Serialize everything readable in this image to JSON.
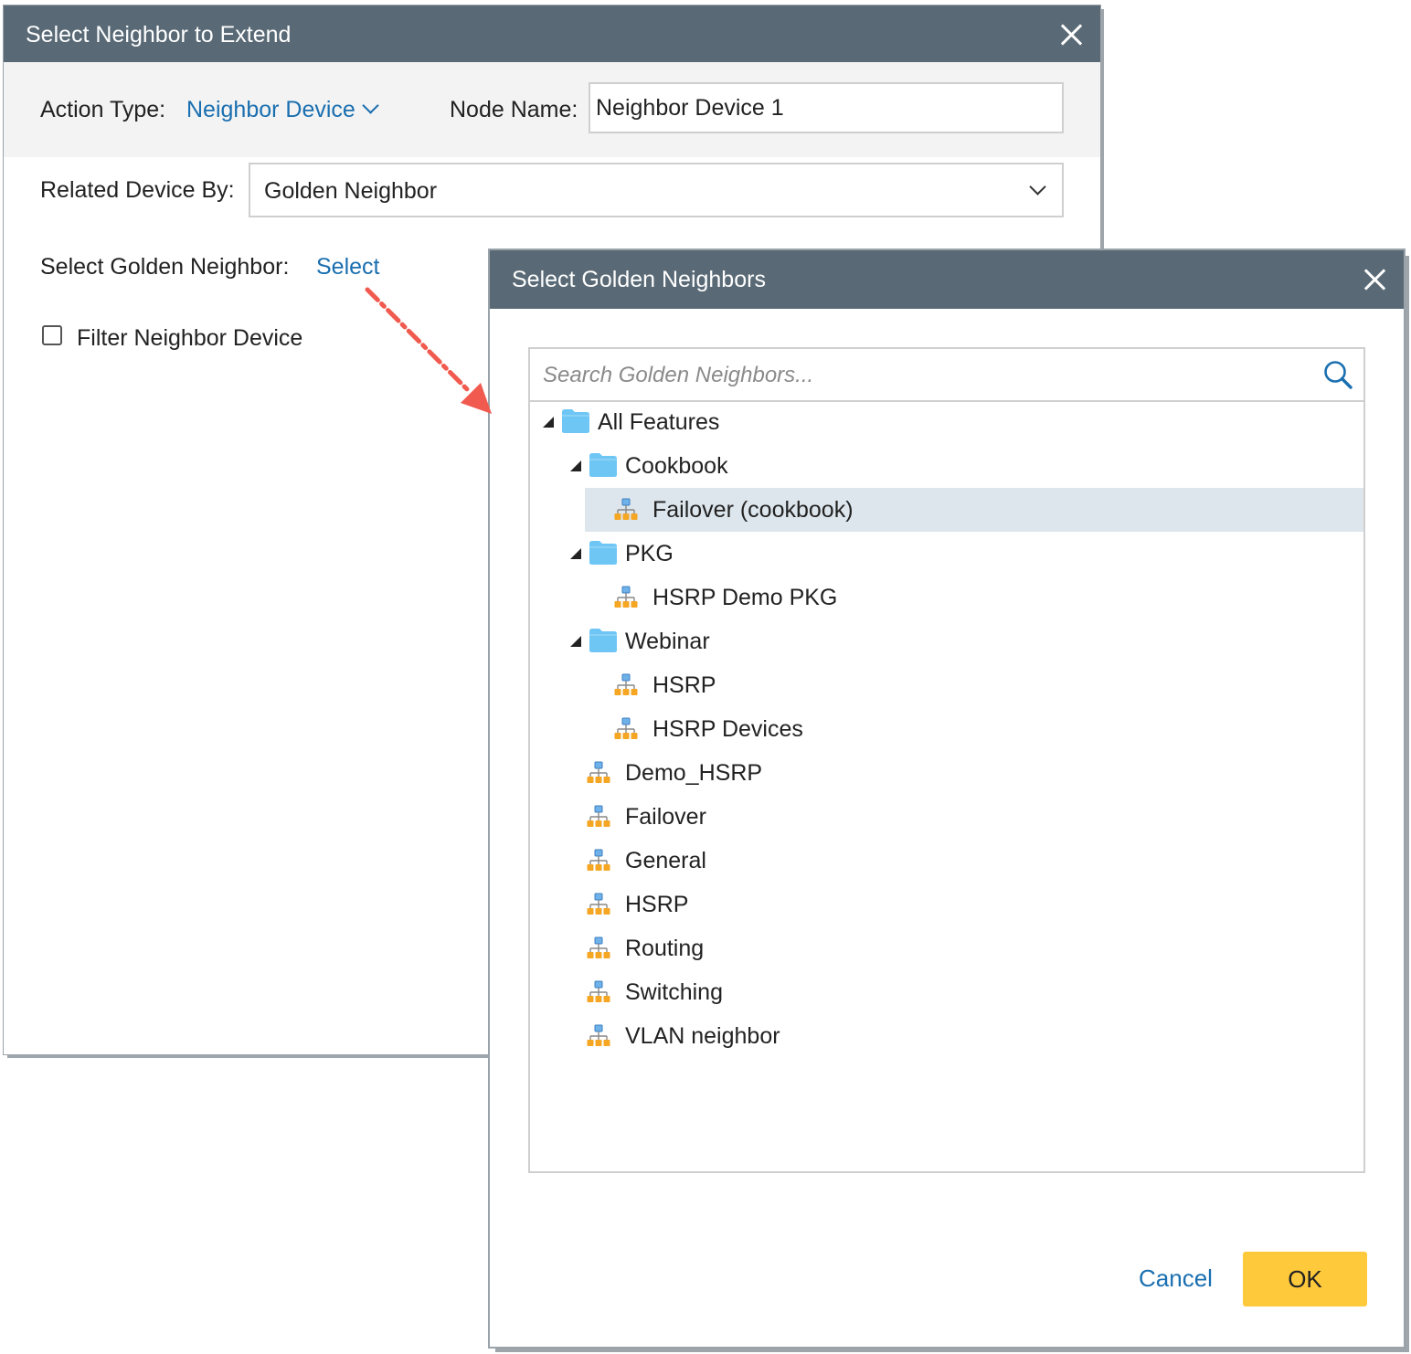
{
  "extend_dialog": {
    "title": "Select Neighbor to Extend",
    "action_type_label": "Action Type:",
    "action_type_value": "Neighbor Device",
    "node_name_label": "Node Name:",
    "node_name_value": "Neighbor Device 1",
    "related_by_label": "Related Device By:",
    "related_by_value": "Golden Neighbor",
    "select_golden_label": "Select Golden Neighbor:",
    "select_link": "Select",
    "filter_label": "Filter Neighbor Device",
    "filter_checked": false
  },
  "golden_dialog": {
    "title": "Select Golden Neighbors",
    "search_placeholder": "Search Golden Neighbors...",
    "tree": [
      {
        "label": "All Features",
        "type": "folder",
        "level": 0,
        "expanded": true
      },
      {
        "label": "Cookbook",
        "type": "folder",
        "level": 1,
        "expanded": true
      },
      {
        "label": "Failover (cookbook)",
        "type": "node",
        "level": 2,
        "selected": true
      },
      {
        "label": "PKG",
        "type": "folder",
        "level": 1,
        "expanded": true
      },
      {
        "label": "HSRP Demo PKG",
        "type": "node",
        "level": 2
      },
      {
        "label": "Webinar",
        "type": "folder",
        "level": 1,
        "expanded": true
      },
      {
        "label": "HSRP",
        "type": "node",
        "level": 2
      },
      {
        "label": "HSRP Devices",
        "type": "node",
        "level": 2
      },
      {
        "label": "Demo_HSRP",
        "type": "node",
        "level": 1
      },
      {
        "label": "Failover",
        "type": "node",
        "level": 1
      },
      {
        "label": "General",
        "type": "node",
        "level": 1
      },
      {
        "label": "HSRP",
        "type": "node",
        "level": 1
      },
      {
        "label": "Routing",
        "type": "node",
        "level": 1
      },
      {
        "label": "Switching",
        "type": "node",
        "level": 1
      },
      {
        "label": "VLAN neighbor",
        "type": "node",
        "level": 1
      }
    ],
    "cancel_label": "Cancel",
    "ok_label": "OK"
  },
  "colors": {
    "header_bg": "#596a76",
    "link": "#1a6fb0",
    "ok_button": "#ffc93c",
    "selected_row": "#dde6ed",
    "folder": "#6ec6f5",
    "arrow": "#f05a4f"
  }
}
